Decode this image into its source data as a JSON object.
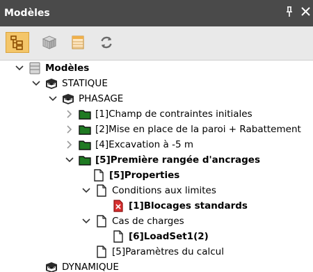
{
  "window": {
    "title": "Modèles",
    "pin_glyph": "ꟼ",
    "close_glyph": "×"
  },
  "toolbar": {
    "buttons": [
      {
        "icon": "tree-view-icon",
        "active": true
      },
      {
        "icon": "model-view-icon",
        "active": false
      },
      {
        "icon": "table-view-icon",
        "active": false
      },
      {
        "icon": "refresh-icon",
        "active": false
      }
    ]
  },
  "tree": {
    "root": "Modèles",
    "statique": "STATIQUE",
    "phasage": "PHASAGE",
    "phase1": "[1]Champ de contraintes initiales",
    "phase2": "[2]Mise en place de la paroi + Rabattement",
    "phase4": "[4]Excavation à -5 m",
    "phase5": "[5]Première rangée d'ancrages",
    "properties": "[5]Properties",
    "conditions": "Conditions aux limites",
    "blocages": "[1]Blocages standards",
    "cas": "Cas de charges",
    "loadset": "[6]LoadSet1(2)",
    "params": "[5]Paramètres du calcul",
    "dynamique": "DYNAMIQUE"
  },
  "colors": {
    "titlebar": "#4a4a4a",
    "toolbar": "#e9e9e9",
    "active_button": "#f4c66a",
    "folder_green": "#1f7a22",
    "error_red": "#d83030"
  }
}
